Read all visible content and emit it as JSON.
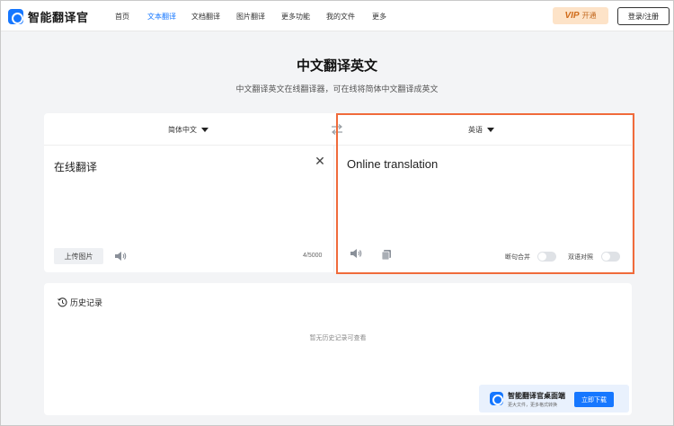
{
  "brand": {
    "name": "智能翻译官"
  },
  "nav": {
    "items": [
      {
        "label": "首页"
      },
      {
        "label": "文本翻译"
      },
      {
        "label": "文档翻译"
      },
      {
        "label": "图片翻译"
      },
      {
        "label": "更多功能"
      },
      {
        "label": "我的文件"
      },
      {
        "label": "更多"
      }
    ],
    "vip": {
      "badge": "VIP",
      "label": "开通"
    },
    "login_label": "登录/注册"
  },
  "header": {
    "title": "中文翻译英文",
    "subtitle": "中文翻译英文在线翻译器，可在线将简体中文翻译成英文"
  },
  "translator": {
    "source_lang": "简体中文",
    "target_lang": "英语",
    "source_text": "在线翻译",
    "target_text": "Online translation",
    "upload_label": "上传图片",
    "char_count": "4/5000",
    "toggle_split": {
      "label": "断句合并",
      "on": false
    },
    "toggle_bilingual": {
      "label": "双语对照",
      "on": false
    }
  },
  "history": {
    "title": "历史记录",
    "empty_text": "暂无历史记录可查看",
    "promo": {
      "title": "智能翻译官桌面端",
      "subtitle": "更大文件，更多格式转换",
      "button_label": "立即下载"
    }
  },
  "colors": {
    "accent": "#1677ff",
    "highlight_border": "#f06b3b",
    "vip_bg": "#fde3c8"
  }
}
